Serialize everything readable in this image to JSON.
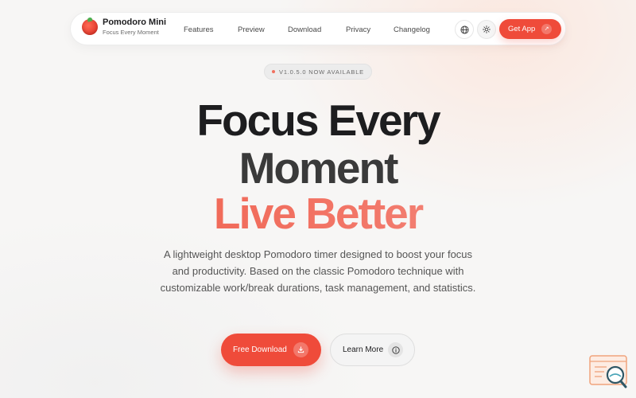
{
  "nav": {
    "brand_name": "Pomodoro Mini",
    "brand_tagline": "Focus Every Moment",
    "links": [
      "Features",
      "Preview",
      "Download",
      "Privacy",
      "Changelog"
    ],
    "globe_icon": "globe-icon",
    "theme_icon": "sun-icon",
    "get_app_label": "Get App",
    "get_app_icon": "arrow-up-right-icon"
  },
  "badge": {
    "text": "V1.0.5.0 NOW AVAILABLE",
    "dot_color": "#f0705f"
  },
  "hero": {
    "line1": "Focus Every",
    "line2": "Moment",
    "line3": "Live Better",
    "description": "A lightweight desktop Pomodoro timer designed to boost your focus and productivity. Based on the classic Pomodoro technique with customizable work/break durations, task management, and statistics."
  },
  "cta": {
    "primary_label": "Free Download",
    "primary_icon": "download-icon",
    "secondary_label": "Learn More",
    "secondary_icon": "info-icon"
  },
  "colors": {
    "accent": "#ef4b3a",
    "gradient_end": "#f7a196",
    "heading": "#1d1d1f",
    "body_text": "#555555",
    "background": "#f7f6f5"
  }
}
